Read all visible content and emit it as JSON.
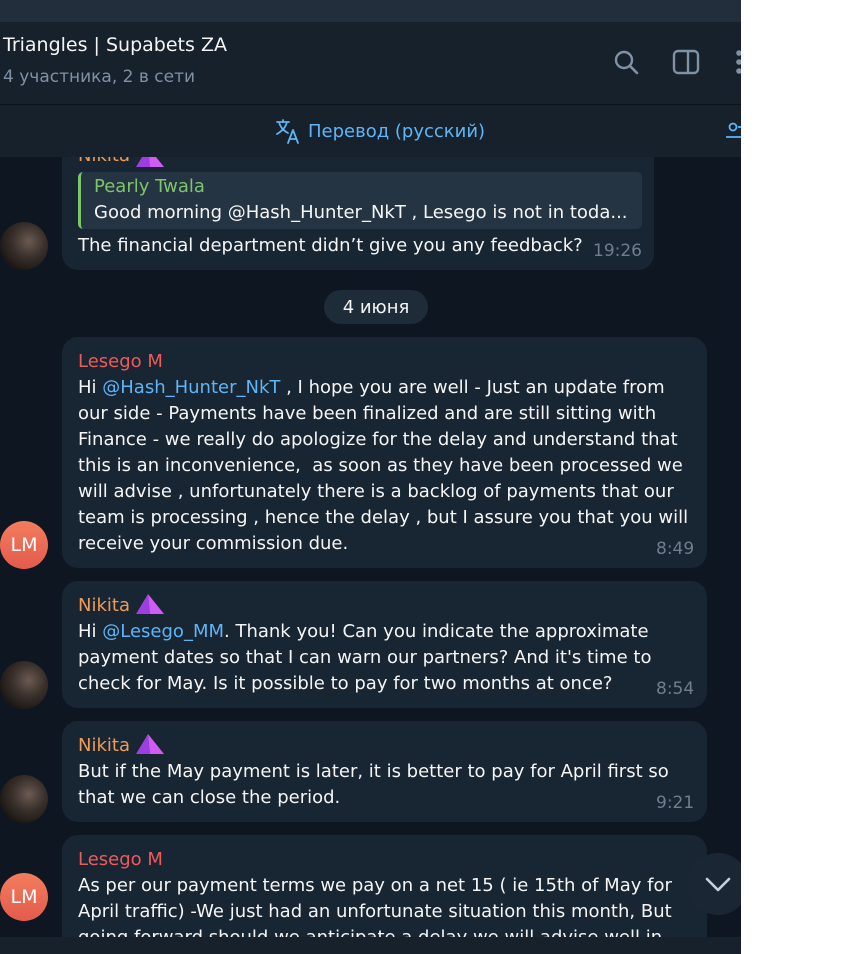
{
  "chat": {
    "title": "Triangles | Supabets ZA",
    "subtitle": "4 участника, 2 в сети"
  },
  "header_icons": [
    "search-icon",
    "sidebar-toggle-icon",
    "more-vertical-icon"
  ],
  "translate_bar": {
    "label": "Перевод (русский)"
  },
  "messages": [
    {
      "sender": "Nikita",
      "reply": {
        "name": "Pearly Twala",
        "text": "Good morning @Hash_Hunter_NkT , Lesego is not in toda..."
      },
      "text": "The financial department didn’t give you any feedback?",
      "time": "19:26"
    },
    {
      "sender": "Lesego M",
      "avatar": "LM",
      "mention": "@Hash_Hunter_NkT",
      "lines": [
        "Hi ",
        " , I hope you are well - Just an update from",
        "our side - Payments have been finalized and are still sitting with",
        "Finance - we really do apologize for the delay and understand that",
        "this is an inconvenience,  as soon as they have been processed we",
        "will advise , unfortunately there is a backlog of payments that our",
        "team is processing , hence the delay , but I assure you that you will",
        "receive your commission due."
      ],
      "time": "8:49"
    },
    {
      "sender": "Nikita",
      "mention": "@Lesego_MM",
      "lines": [
        "Hi ",
        ". Thank you! Can you indicate the approximate",
        "payment dates so that I can warn our partners? And it's time to",
        "check for May. Is it possible to pay for two months at once?"
      ],
      "time": "8:54"
    },
    {
      "sender": "Nikita",
      "lines": [
        "But if the May payment is later, it is better to pay for April first so",
        "that we can close the period."
      ],
      "time": "9:21"
    },
    {
      "sender": "Lesego M",
      "avatar": "LM",
      "lines": [
        "As per our payment terms we pay on a net 15 ( ie 15th of May for",
        "April traffic) -We just had an unfortunate situation this month, But",
        "going forward should we anticipate a delay we will advise well in"
      ]
    }
  ],
  "date_separator": "4 июня",
  "colors": {
    "background": "#0e1621",
    "header": "#17212b",
    "bubble": "#182533",
    "link": "#5eb5f7",
    "nikita_name": "#ef9b55",
    "lesego_name": "#ef5b5b",
    "reply_name": "#7ec56a",
    "time": "#6d7f8f"
  }
}
